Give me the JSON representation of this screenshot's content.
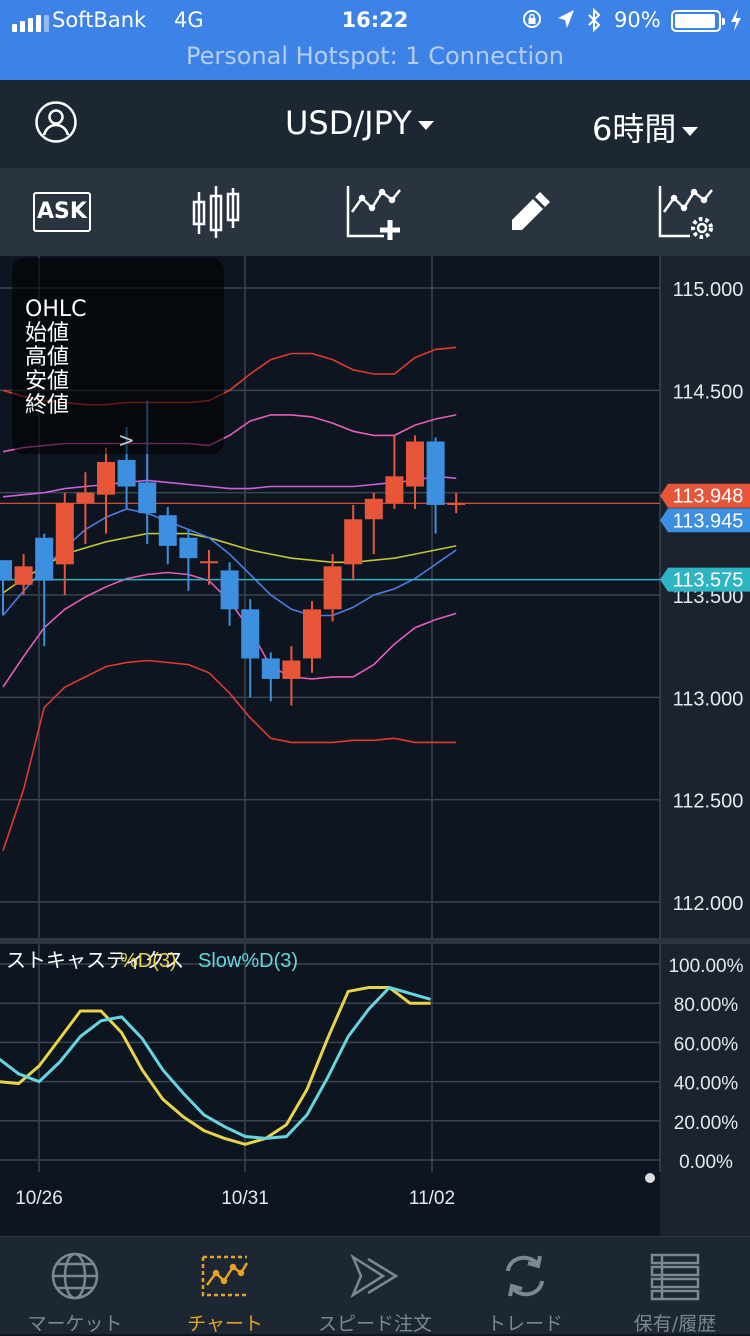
{
  "status_bar": {
    "carrier": "SoftBank",
    "network": "4G",
    "time": "16:22",
    "battery": "90%",
    "hotspot": "Personal Hotspot: 1 Connection"
  },
  "header": {
    "pair": "USD/JPY",
    "timeframe": "6時間"
  },
  "toolbar": {
    "ask": "ASK"
  },
  "ohlc_panel": {
    "title": "OHLC",
    "lines": [
      "始値",
      "高値",
      "安値",
      "終値"
    ]
  },
  "price_axis": {
    "ticks": [
      "115.000",
      "114.500",
      "113.500",
      "113.000",
      "112.500",
      "112.000"
    ],
    "tags": {
      "bid": "113.948",
      "ask": "113.945",
      "line": "113.575"
    }
  },
  "stochastics": {
    "title": "ストキャスティクス",
    "d_label": "%D(3)",
    "slow_label": "Slow%D(3)",
    "ticks": [
      "100.00%",
      "80.00%",
      "60.00%",
      "40.00%",
      "20.00%",
      "0.00%"
    ]
  },
  "date_axis": [
    "10/26",
    "10/31",
    "11/02"
  ],
  "colors": {
    "up": "#e8563a",
    "down": "#3d8fe0",
    "bid_tag": "#e8563a",
    "ask_tag": "#3d8fe0",
    "line_tag": "#2fb4c4",
    "d_line": "#e8d34a",
    "slow_line": "#66d5e0",
    "accent": "#e6a322"
  },
  "tab_bar": [
    {
      "label": "マーケット",
      "icon": "globe-icon",
      "active": false
    },
    {
      "label": "チャート",
      "icon": "chart-icon",
      "active": true
    },
    {
      "label": "スピード注文",
      "icon": "speed-order-icon",
      "active": false
    },
    {
      "label": "トレード",
      "icon": "trade-icon",
      "active": false
    },
    {
      "label": "保有/履歴",
      "icon": "list-icon",
      "active": false
    }
  ],
  "chart_data": [
    {
      "type": "candlestick",
      "title": "USD/JPY 6時間",
      "ylim": [
        111.8,
        115.1
      ],
      "yticks": [
        112.0,
        112.5,
        113.0,
        113.5,
        114.0,
        114.5,
        115.0
      ],
      "xlabels": [
        "10/26",
        "10/31",
        "11/02"
      ],
      "candles": [
        {
          "o": 113.67,
          "c": 113.57,
          "h": 113.67,
          "l": 113.4
        },
        {
          "o": 113.55,
          "c": 113.64,
          "h": 113.7,
          "l": 113.5
        },
        {
          "o": 113.78,
          "c": 113.57,
          "h": 113.8,
          "l": 113.25
        },
        {
          "o": 113.65,
          "c": 113.95,
          "h": 114.0,
          "l": 113.5
        },
        {
          "o": 113.95,
          "c": 114.0,
          "h": 114.1,
          "l": 113.75
        },
        {
          "o": 113.99,
          "c": 114.15,
          "h": 114.22,
          "l": 113.8
        },
        {
          "o": 114.16,
          "c": 114.03,
          "h": 114.32,
          "l": 113.92
        },
        {
          "o": 114.05,
          "c": 113.9,
          "h": 114.45,
          "l": 113.75
        },
        {
          "o": 113.89,
          "c": 113.74,
          "h": 113.93,
          "l": 113.65
        },
        {
          "o": 113.78,
          "c": 113.68,
          "h": 113.82,
          "l": 113.52
        },
        {
          "o": 113.66,
          "c": 113.66,
          "h": 113.72,
          "l": 113.55
        },
        {
          "o": 113.62,
          "c": 113.43,
          "h": 113.66,
          "l": 113.35
        },
        {
          "o": 113.43,
          "c": 113.19,
          "h": 113.48,
          "l": 113.0
        },
        {
          "o": 113.19,
          "c": 113.09,
          "h": 113.22,
          "l": 112.98
        },
        {
          "o": 113.09,
          "c": 113.18,
          "h": 113.25,
          "l": 112.96
        },
        {
          "o": 113.19,
          "c": 113.43,
          "h": 113.47,
          "l": 113.12
        },
        {
          "o": 113.43,
          "c": 113.64,
          "h": 113.7,
          "l": 113.37
        },
        {
          "o": 113.65,
          "c": 113.87,
          "h": 113.94,
          "l": 113.57
        },
        {
          "o": 113.87,
          "c": 113.97,
          "h": 114.0,
          "l": 113.7
        },
        {
          "o": 113.95,
          "c": 114.08,
          "h": 114.28,
          "l": 113.92
        },
        {
          "o": 114.03,
          "c": 114.25,
          "h": 114.28,
          "l": 113.92
        },
        {
          "o": 114.25,
          "c": 113.94,
          "h": 114.27,
          "l": 113.8
        },
        {
          "o": 113.94,
          "c": 113.95,
          "h": 114.0,
          "l": 113.9
        }
      ],
      "bands": [
        {
          "name": "upper2",
          "color": "#e23a2e",
          "values": [
            114.5,
            114.47,
            114.45,
            114.44,
            114.43,
            114.43,
            114.44,
            114.44,
            114.44,
            114.44,
            114.45,
            114.5,
            114.58,
            114.65,
            114.68,
            114.68,
            114.65,
            114.6,
            114.58,
            114.58,
            114.66,
            114.7,
            114.71
          ]
        },
        {
          "name": "upper1",
          "color": "#e65cba",
          "values": [
            114.2,
            114.22,
            114.23,
            114.24,
            114.24,
            114.24,
            114.24,
            114.24,
            114.24,
            114.24,
            114.23,
            114.28,
            114.35,
            114.38,
            114.38,
            114.37,
            114.34,
            114.3,
            114.28,
            114.28,
            114.33,
            114.36,
            114.38
          ]
        },
        {
          "name": "inner",
          "color": "#cc60d8",
          "values": [
            113.98,
            113.99,
            114.0,
            114.02,
            114.03,
            114.04,
            114.05,
            114.06,
            114.05,
            114.04,
            114.03,
            114.02,
            114.02,
            114.03,
            114.03,
            114.03,
            114.03,
            114.03,
            114.04,
            114.05,
            114.06,
            114.08,
            114.07
          ]
        },
        {
          "name": "ma_long",
          "color": "#c2c43a",
          "values": [
            113.51,
            113.58,
            113.64,
            113.7,
            113.73,
            113.76,
            113.78,
            113.8,
            113.8,
            113.8,
            113.78,
            113.75,
            113.72,
            113.7,
            113.68,
            113.67,
            113.66,
            113.66,
            113.67,
            113.68,
            113.7,
            113.72,
            113.74
          ]
        },
        {
          "name": "ma_short",
          "color": "#4d7de0",
          "values": [
            113.4,
            113.52,
            113.63,
            113.73,
            113.82,
            113.88,
            113.92,
            113.9,
            113.86,
            113.82,
            113.78,
            113.7,
            113.6,
            113.5,
            113.43,
            113.4,
            113.4,
            113.44,
            113.5,
            113.53,
            113.58,
            113.65,
            113.72
          ]
        },
        {
          "name": "lower1",
          "color": "#e65cba",
          "values": [
            113.05,
            113.2,
            113.34,
            113.43,
            113.49,
            113.54,
            113.58,
            113.6,
            113.61,
            113.6,
            113.57,
            113.47,
            113.33,
            113.15,
            113.1,
            113.09,
            113.1,
            113.1,
            113.16,
            113.26,
            113.34,
            113.38,
            113.41
          ]
        },
        {
          "name": "lower2",
          "color": "#e23a2e",
          "values": [
            112.25,
            112.55,
            112.95,
            113.05,
            113.1,
            113.15,
            113.17,
            113.18,
            113.17,
            113.16,
            113.12,
            113.02,
            112.9,
            112.8,
            112.78,
            112.78,
            112.78,
            112.79,
            112.79,
            112.8,
            112.78,
            112.78,
            112.78
          ]
        }
      ],
      "hlines": [
        113.948,
        113.575
      ]
    },
    {
      "type": "line",
      "title": "ストキャスティクス",
      "ylim": [
        0,
        100
      ],
      "yticks": [
        0,
        20,
        40,
        60,
        80,
        100
      ],
      "series": [
        {
          "name": "%D(3)",
          "values": [
            40,
            39,
            48,
            62,
            76,
            76,
            65,
            46,
            31,
            22,
            15,
            11,
            8,
            11,
            18,
            36,
            62,
            86,
            88,
            88,
            80,
            80
          ]
        },
        {
          "name": "Slow%D(3)",
          "values": [
            52,
            44,
            40,
            50,
            63,
            71,
            73,
            62,
            46,
            34,
            23,
            17,
            12,
            11,
            12,
            23,
            42,
            63,
            77,
            88,
            85,
            82
          ]
        }
      ]
    }
  ]
}
